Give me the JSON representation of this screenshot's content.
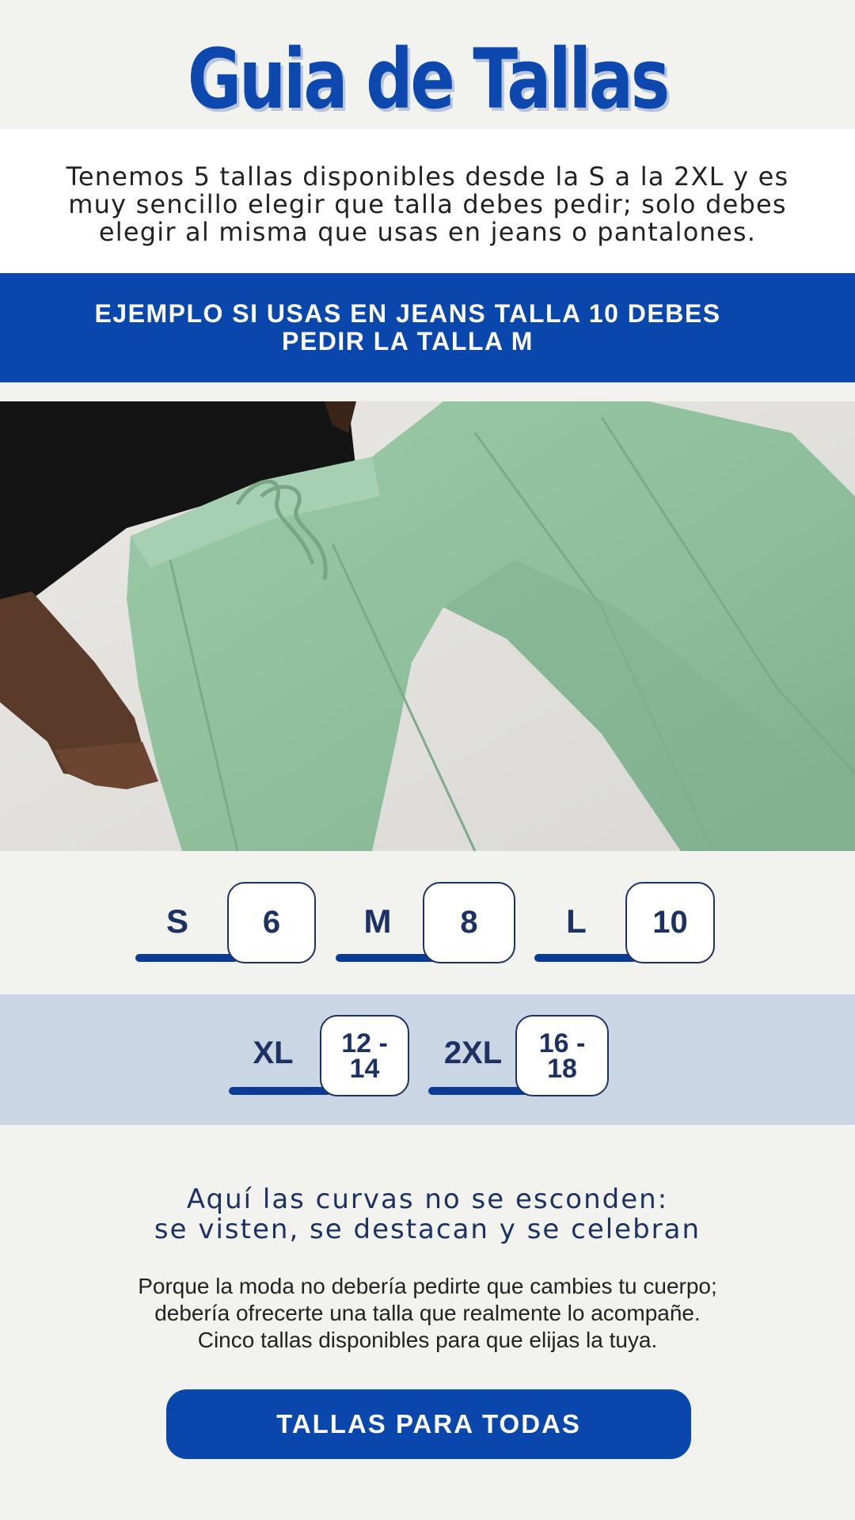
{
  "header": {
    "title": "Guia de Tallas"
  },
  "intro": {
    "text_lines": [
      "Tenemos 5 tallas disponibles desde la S a la 2XL y es",
      "muy sencillo elegir que talla debes pedir; solo debes",
      "elegir al misma que usas en jeans o pantalones."
    ]
  },
  "example": {
    "lines": [
      "EJEMPLO SI USAS EN JEANS TALLA 10 DEBES",
      "PEDIR LA TALLA M"
    ]
  },
  "sizes_row1": [
    {
      "size": "S",
      "jeans": [
        "6"
      ]
    },
    {
      "size": "M",
      "jeans": [
        "8"
      ]
    },
    {
      "size": "L",
      "jeans": [
        "10"
      ]
    }
  ],
  "sizes_row2": [
    {
      "size": "XL",
      "jeans": [
        "12 -",
        "14"
      ]
    },
    {
      "size": "2XL",
      "jeans": [
        "16 -",
        "18"
      ]
    }
  ],
  "headline": {
    "lines": [
      "Aquí las curvas no se esconden:",
      "se visten, se destacan y se celebran"
    ]
  },
  "body": {
    "lines": [
      "Porque la moda no debería pedirte que cambies tu cuerpo;",
      "debería ofrecerte una talla que realmente lo acompañe.",
      "Cinco tallas disponibles para que elijas la tuya."
    ]
  },
  "cta": {
    "label": "TALLAS PARA TODAS"
  },
  "colors": {
    "brand_blue": "#0a47ad",
    "navy": "#1d3263",
    "pants_green": "#8fbd9b",
    "band_light_blue": "#cbd6e5"
  }
}
